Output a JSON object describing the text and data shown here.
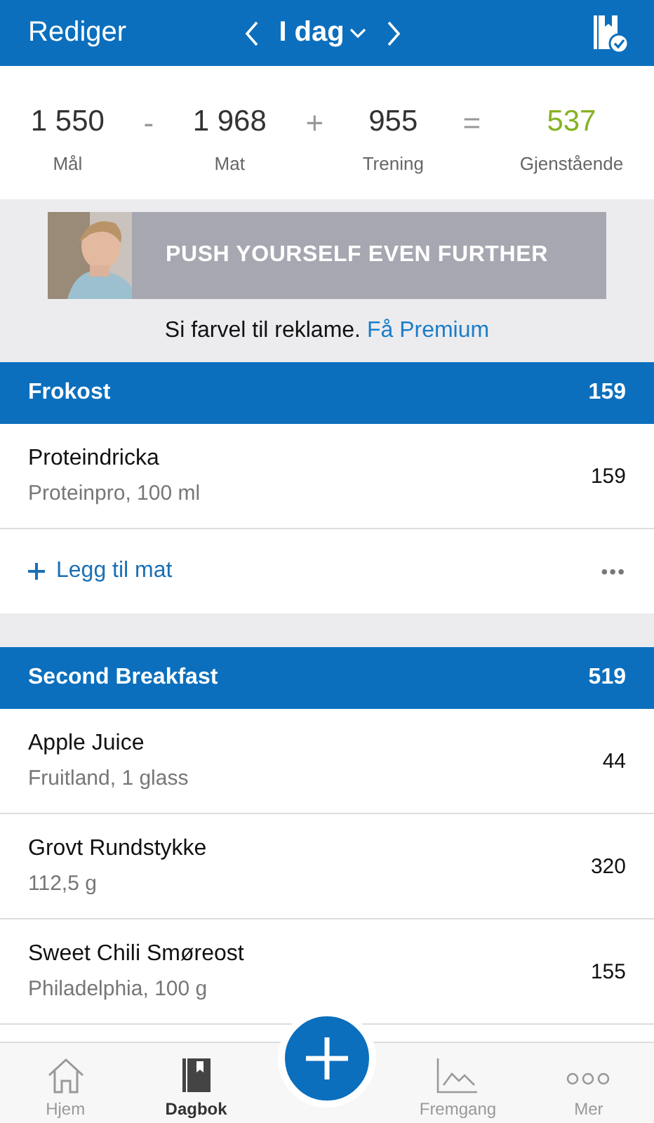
{
  "header": {
    "edit": "Rediger",
    "date": "I dag"
  },
  "summary": [
    {
      "kind": "value",
      "value": "1 550",
      "label": "Mål",
      "highlight": false
    },
    {
      "kind": "operator",
      "value": "-"
    },
    {
      "kind": "value",
      "value": "1 968",
      "label": "Mat",
      "highlight": false
    },
    {
      "kind": "operator",
      "value": "+"
    },
    {
      "kind": "value",
      "value": "955",
      "label": "Trening",
      "highlight": false
    },
    {
      "kind": "operator",
      "value": "="
    },
    {
      "kind": "value",
      "value": "537",
      "label": "Gjenstående",
      "highlight": true
    }
  ],
  "ad": {
    "headline": "PUSH YOURSELF EVEN FURTHER",
    "text": "Si farvel til reklame.",
    "link": "Få Premium"
  },
  "meals": [
    {
      "name": "Frokost",
      "total": "159",
      "add_label": "Legg til mat",
      "more": "•••",
      "foods": [
        {
          "name": "Proteindricka",
          "detail": "Proteinpro, 100 ml",
          "calories": "159"
        }
      ]
    },
    {
      "name": "Second Breakfast",
      "total": "519",
      "foods": [
        {
          "name": "Apple Juice",
          "detail": "Fruitland, 1 glass",
          "calories": "44"
        },
        {
          "name": "Grovt Rundstykke",
          "detail": "112,5 g",
          "calories": "320"
        },
        {
          "name": "Sweet Chili Smøreost",
          "detail": "Philadelphia, 100 g",
          "calories": "155"
        }
      ]
    }
  ],
  "tab_bar": [
    {
      "kind": "home",
      "label": "Hjem",
      "selected": false
    },
    {
      "kind": "diary",
      "label": "Dagbok",
      "selected": true
    },
    {
      "kind": "add"
    },
    {
      "kind": "progress",
      "label": "Fremgang",
      "selected": false
    },
    {
      "kind": "more",
      "label": "Mer",
      "selected": false
    }
  ]
}
